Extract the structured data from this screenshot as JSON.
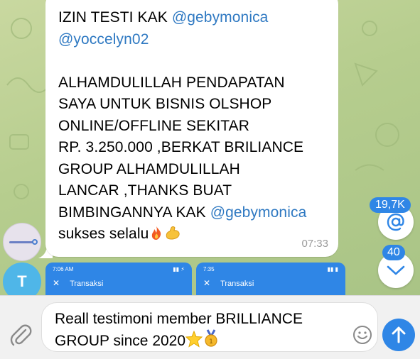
{
  "message": {
    "line1_prefix": "IZIN TESTI KAK ",
    "mention1": "@gebymonica",
    "mention2": "@yoccelyn02",
    "body_lines": [
      "ALHAMDULILLAH PENDAPATAN",
      "SAYA UNTUK BISNIS OLSHOP",
      "ONLINE/OFFLINE SEKITAR",
      "RP. 3.250.000 ,BERKAT BRILIANCE",
      "GROUP ALHAMDULILLAH",
      "LANCAR ,THANKS BUAT"
    ],
    "last_line_prefix": "BIMBINGANNYA KAK ",
    "mention3": "@gebymonica",
    "closing": "sukses selalu",
    "time": "07:33"
  },
  "avatar_letter": "T",
  "media_thumbs": [
    {
      "status_time": "7:06 AM",
      "title": "Transaksi"
    },
    {
      "status_time": "7:35",
      "title": "Transaksi"
    }
  ],
  "mentions_badge": "19,7K",
  "unread_badge": "40",
  "composer": {
    "text_line1": "Reall testimoni member BRILLIANCE",
    "text_line2": "GROUP since 2020"
  },
  "icons": [
    "flexed-biceps-icon",
    "fire-icon",
    "star-icon",
    "medal-icon",
    "at-sign-icon",
    "chevron-down-icon",
    "paperclip-icon",
    "smiley-icon",
    "send-arrow-icon"
  ],
  "colors": {
    "accent": "#2f86e6",
    "mention": "#2f79c2",
    "avatar": "#4fb6e8"
  }
}
